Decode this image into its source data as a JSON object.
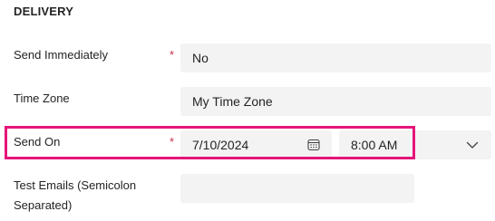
{
  "section": {
    "title": "DELIVERY"
  },
  "fields": {
    "send_immediately": {
      "label": "Send Immediately",
      "required_mark": "*",
      "value": "No"
    },
    "time_zone": {
      "label": "Time Zone",
      "value": "My Time Zone"
    },
    "send_on": {
      "label": "Send On",
      "required_mark": "*",
      "date_value": "7/10/2024",
      "time_value": "8:00 AM"
    },
    "test_emails": {
      "label_line1": "Test Emails (Semicolon",
      "label_line2": "Separated)",
      "value": ""
    }
  },
  "icons": {
    "calendar": "calendar-icon",
    "chevron": "chevron-down-icon"
  },
  "colors": {
    "highlight": "#e5157a",
    "required": "#c4314b",
    "field_background": "#f3f3f3"
  }
}
